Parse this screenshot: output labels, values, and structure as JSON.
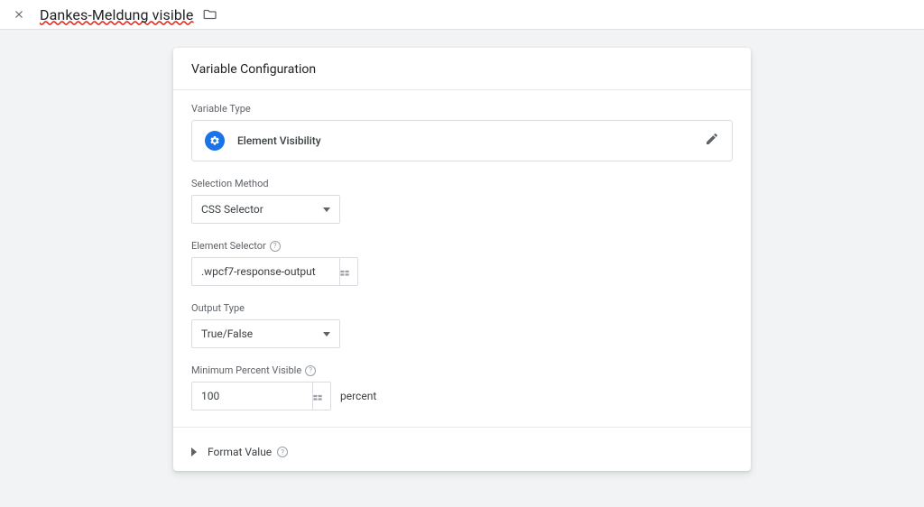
{
  "header": {
    "title": "Dankes-Meldung visible"
  },
  "card": {
    "heading": "Variable Configuration",
    "variable_type_label": "Variable Type",
    "variable_type_value": "Element Visibility",
    "selection_method_label": "Selection Method",
    "selection_method_value": "CSS Selector",
    "element_selector_label": "Element Selector",
    "element_selector_value": ".wpcf7-response-output",
    "output_type_label": "Output Type",
    "output_type_value": "True/False",
    "min_percent_label": "Minimum Percent Visible",
    "min_percent_value": "100",
    "percent_unit": "percent",
    "format_value_label": "Format Value"
  }
}
